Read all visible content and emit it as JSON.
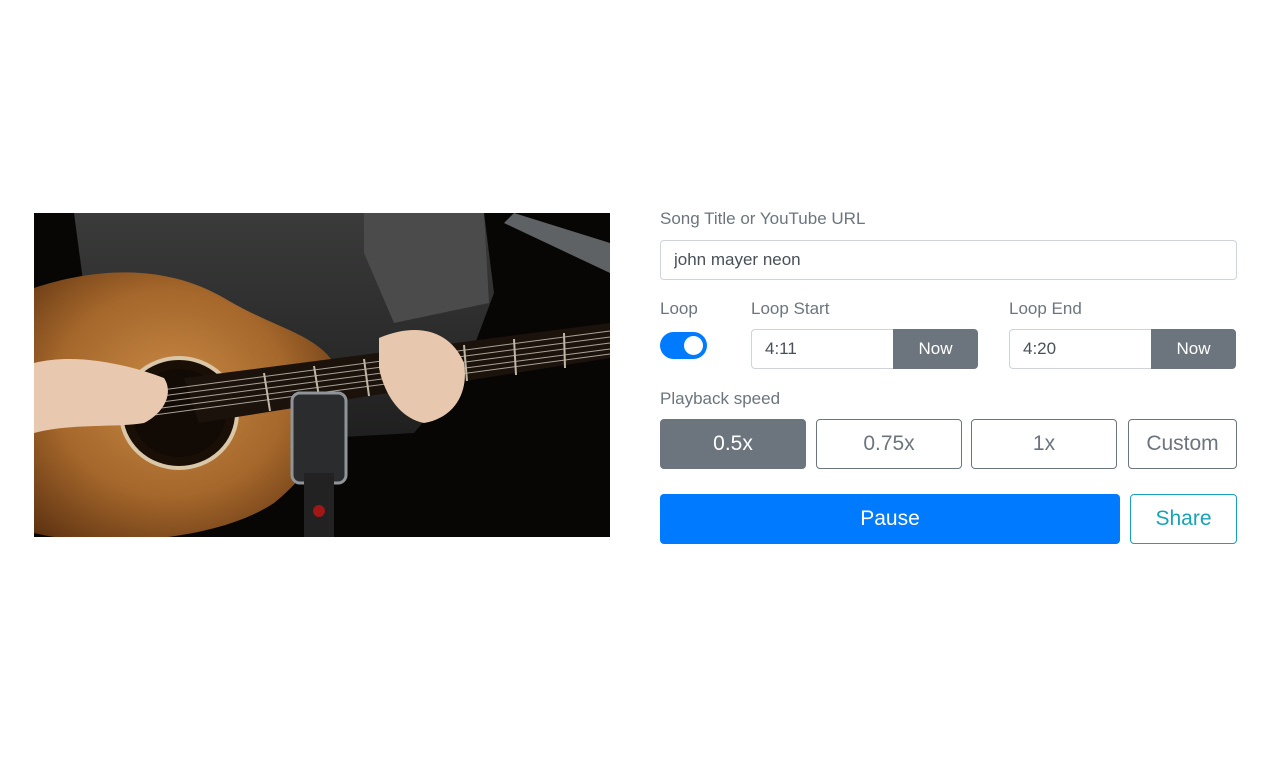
{
  "search": {
    "label": "Song Title or YouTube URL",
    "value": "john mayer neon"
  },
  "loop": {
    "label": "Loop",
    "enabled": true,
    "start_label": "Loop Start",
    "start_value": "4:11",
    "start_now_label": "Now",
    "end_label": "Loop End",
    "end_value": "4:20",
    "end_now_label": "Now"
  },
  "playback": {
    "label": "Playback speed",
    "options": [
      "0.5x",
      "0.75x",
      "1x",
      "Custom"
    ],
    "selected": "0.5x"
  },
  "actions": {
    "pause_label": "Pause",
    "share_label": "Share"
  },
  "video": {
    "icon": "video-player",
    "content": "acoustic-guitar-performance"
  },
  "colors": {
    "primary": "#007bff",
    "secondary": "#6c757d",
    "info": "#17a2b8"
  }
}
